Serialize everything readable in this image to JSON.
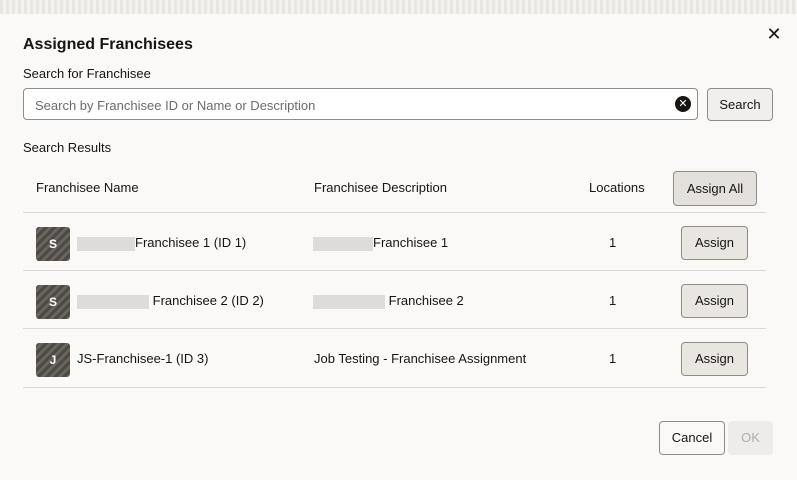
{
  "dialog": {
    "title": "Assigned Franchisees",
    "close_symbol": "✕"
  },
  "search": {
    "label": "Search for Franchisee",
    "placeholder": "Search by Franchisee ID or Name or Description",
    "value": "",
    "clear_symbol": "✕",
    "button_label": "Search"
  },
  "results": {
    "label": "Search Results",
    "columns": {
      "name": "Franchisee Name",
      "description": "Franchisee Description",
      "locations": "Locations"
    },
    "assign_all_label": "Assign All",
    "rows": [
      {
        "initial": "S",
        "name": "Franchisee 1 (ID 1)",
        "description": "Franchisee 1",
        "locations": "1",
        "action": "Assign"
      },
      {
        "initial": "S",
        "name": "Franchisee 2 (ID 2)",
        "description": "Franchisee 2",
        "locations": "1",
        "action": "Assign"
      },
      {
        "initial": "J",
        "name": "JS-Franchisee-1 (ID 3)",
        "description": "Job Testing - Franchisee Assignment",
        "locations": "1",
        "action": "Assign"
      }
    ]
  },
  "footer": {
    "cancel_label": "Cancel",
    "ok_label": "OK"
  },
  "colors": {
    "background": "#fbf9f8",
    "text": "#161513",
    "border": "#8f8b86",
    "disabled_text": "#b1ada8"
  }
}
